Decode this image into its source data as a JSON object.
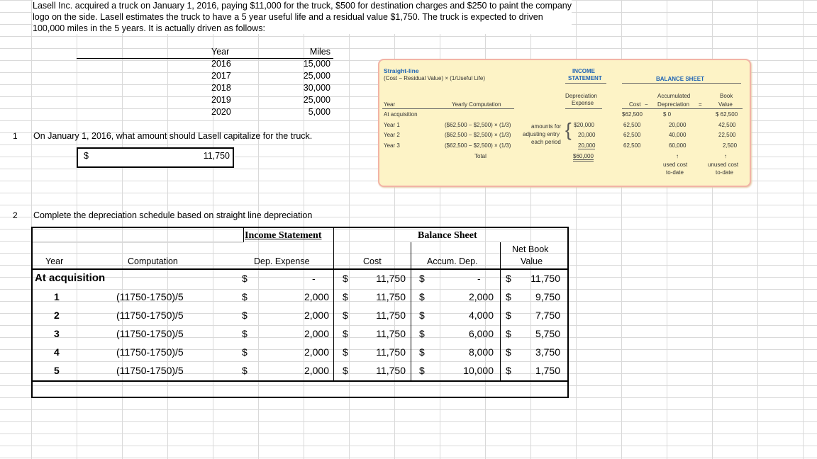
{
  "intro_text": "Lasell Inc. acquired a truck on January 1, 2016, paying $11,000 for the truck, $500 for destination charges and $250 to paint the company logo on the side. Lasell estimates the truck to have a 5 year useful life and a residual value $1,750. The truck is expected to driven 100,000 miles in the 5 years. It is actually driven as follows:",
  "miles_table": {
    "headers": [
      "Year",
      "Miles"
    ],
    "rows": [
      [
        "2016",
        "15,000"
      ],
      [
        "2017",
        "25,000"
      ],
      [
        "2018",
        "30,000"
      ],
      [
        "2019",
        "25,000"
      ],
      [
        "2020",
        "5,000"
      ]
    ]
  },
  "question1": {
    "number": "1",
    "text": "On January 1, 2016, what amount should Lasell capitalize for the truck.",
    "currency": "$",
    "answer": "11,750"
  },
  "question2": {
    "number": "2",
    "text": "Complete the depreciation schedule based on straight line depreciation"
  },
  "textbook_panel": {
    "method_title": "Straight-line",
    "formula": "(Cost − Residual Value) × (1/Useful Life)",
    "income_statement": "INCOME STATEMENT",
    "balance_sheet": "BALANCE SHEET",
    "col_year": "Year",
    "col_yearly_comp": "Yearly Computation",
    "col_dep_expense_1": "Depreciation",
    "col_dep_expense_2": "Expense",
    "col_cost": "Cost",
    "minus": "−",
    "col_accum_1": "Accumulated",
    "col_accum_2": "Depreciation",
    "equals": "=",
    "col_book_1": "Book",
    "col_book_2": "Value",
    "rows": [
      {
        "year": "At acquisition",
        "comp": "",
        "dep": "",
        "cost": "$62,500",
        "accum": "$        0",
        "book": "$ 62,500"
      },
      {
        "year": "Year 1",
        "comp": "($62,500 − $2,500) × (1/3)",
        "dep": "$20,000",
        "cost": "62,500",
        "accum": "20,000",
        "book": "42,500"
      },
      {
        "year": "Year 2",
        "comp": "($62,500 − $2,500) × (1/3)",
        "dep": "20,000",
        "cost": "62,500",
        "accum": "40,000",
        "book": "22,500"
      },
      {
        "year": "Year 3",
        "comp": "($62,500 − $2,500) × (1/3)",
        "dep": "20,000",
        "cost": "62,500",
        "accum": "60,000",
        "book": "2,500"
      }
    ],
    "note_1": "amounts for",
    "note_2": "adjusting entry",
    "note_3": "each period",
    "total_label": "Total",
    "total_value": "$60,000",
    "arrow": "↑",
    "used_cost_1": "used cost",
    "used_cost_2": "to-date",
    "unused_cost_1": "unused cost",
    "unused_cost_2": "to-date"
  },
  "schedule": {
    "income_statement": "Income Statement",
    "balance_sheet": "Balance Sheet",
    "headers": {
      "year": "Year",
      "computation": "Computation",
      "dep_expense": "Dep. Expense",
      "cost": "Cost",
      "accum_dep": "Accum. Dep.",
      "nbv_1": "Net Book",
      "nbv_2": "Value"
    },
    "currency": "$",
    "rows": [
      {
        "year": "At acquisition",
        "comp": "",
        "dep": "-",
        "cost": "11,750",
        "accum": "-",
        "nbv": "11,750"
      },
      {
        "year": "1",
        "comp": "(11750-1750)/5",
        "dep": "2,000",
        "cost": "11,750",
        "accum": "2,000",
        "nbv": "9,750"
      },
      {
        "year": "2",
        "comp": "(11750-1750)/5",
        "dep": "2,000",
        "cost": "11,750",
        "accum": "4,000",
        "nbv": "7,750"
      },
      {
        "year": "3",
        "comp": "(11750-1750)/5",
        "dep": "2,000",
        "cost": "11,750",
        "accum": "6,000",
        "nbv": "5,750"
      },
      {
        "year": "4",
        "comp": "(11750-1750)/5",
        "dep": "2,000",
        "cost": "11,750",
        "accum": "8,000",
        "nbv": "3,750"
      },
      {
        "year": "5",
        "comp": "(11750-1750)/5",
        "dep": "2,000",
        "cost": "11,750",
        "accum": "10,000",
        "nbv": "1,750"
      }
    ]
  }
}
